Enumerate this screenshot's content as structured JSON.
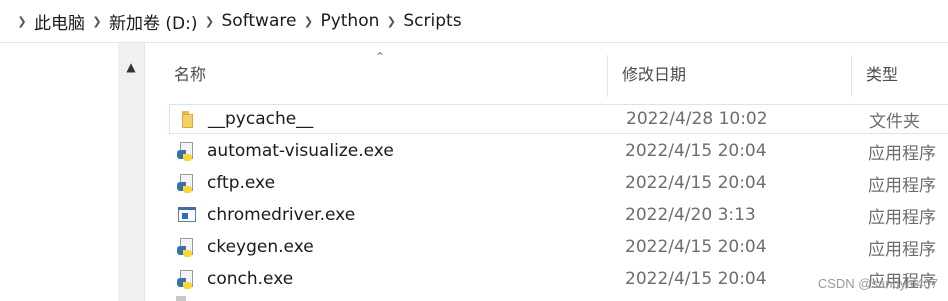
{
  "breadcrumb": [
    "此电脑",
    "新加卷 (D:)",
    "Software",
    "Python",
    "Scripts"
  ],
  "columns": {
    "name": "名称",
    "date": "修改日期",
    "type": "类型"
  },
  "files": [
    {
      "name": "__pycache__",
      "date": "2022/4/28 10:02",
      "type": "文件夹",
      "icon": "folder-icon"
    },
    {
      "name": "automat-visualize.exe",
      "date": "2022/4/15 20:04",
      "type": "应用程序",
      "icon": "python-exe-icon"
    },
    {
      "name": "cftp.exe",
      "date": "2022/4/15 20:04",
      "type": "应用程序",
      "icon": "python-exe-icon"
    },
    {
      "name": "chromedriver.exe",
      "date": "2022/4/20 3:13",
      "type": "应用程序",
      "icon": "application-icon"
    },
    {
      "name": "ckeygen.exe",
      "date": "2022/4/15 20:04",
      "type": "应用程序",
      "icon": "python-exe-icon"
    },
    {
      "name": "conch.exe",
      "date": "2022/4/15 20:04",
      "type": "应用程序",
      "icon": "python-exe-icon"
    }
  ],
  "watermark": "CSDN @sandyhl407"
}
